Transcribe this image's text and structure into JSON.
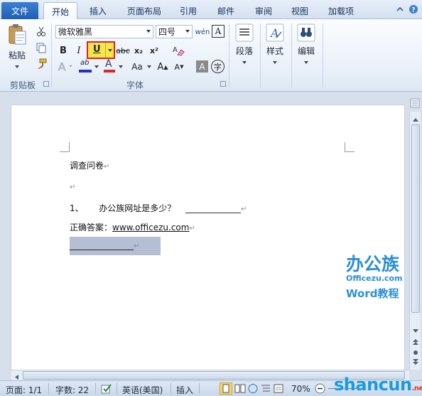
{
  "tabs": {
    "file": "文件",
    "items": [
      "开始",
      "插入",
      "页面布局",
      "引用",
      "邮件",
      "审阅",
      "视图",
      "加载项"
    ],
    "active_index": 0
  },
  "ribbon": {
    "clipboard": {
      "paste_label": "粘贴",
      "group_label": "剪贴板"
    },
    "font": {
      "font_name": "微软雅黑",
      "font_size": "四号",
      "group_label": "字体",
      "bold": "B",
      "italic": "I",
      "underline": "U",
      "strike": "abc",
      "subscript": "x₂",
      "superscript": "x²",
      "grow": "A",
      "shrink": "A",
      "change_case": "Aa",
      "phonetic": "wén",
      "char_border": "A",
      "char_shading": "A",
      "enclose": "字",
      "highlight": "ab",
      "font_color": "A",
      "highlight_box_color": "#e81d1d"
    },
    "paragraph": {
      "label": "段落"
    },
    "styles": {
      "label": "样式"
    },
    "editing": {
      "label": "编辑"
    }
  },
  "document": {
    "title": "调查问卷",
    "q1_number": "1、",
    "q1_text": "办公族网址是多少？",
    "q1_blank": "_____________",
    "answer_label": "正确答案：",
    "answer_url": "www.officezu.com",
    "selected_blank": "_______________"
  },
  "watermark": {
    "logo_cn": "办公族",
    "logo_en": "Officezu.com",
    "subtitle": "Word教程",
    "site": "shancun",
    "site_suffix": ".net"
  },
  "status": {
    "page": "页面: 1/1",
    "words": "字数: 22",
    "language": "英语(美国)",
    "mode": "插入",
    "zoom": "70%"
  },
  "colors": {
    "file_tab": "#2a6cc4",
    "highlight_yellow": "#f5e64a",
    "font_color_red": "#d92a1f",
    "selection": "#b5bfd4"
  }
}
